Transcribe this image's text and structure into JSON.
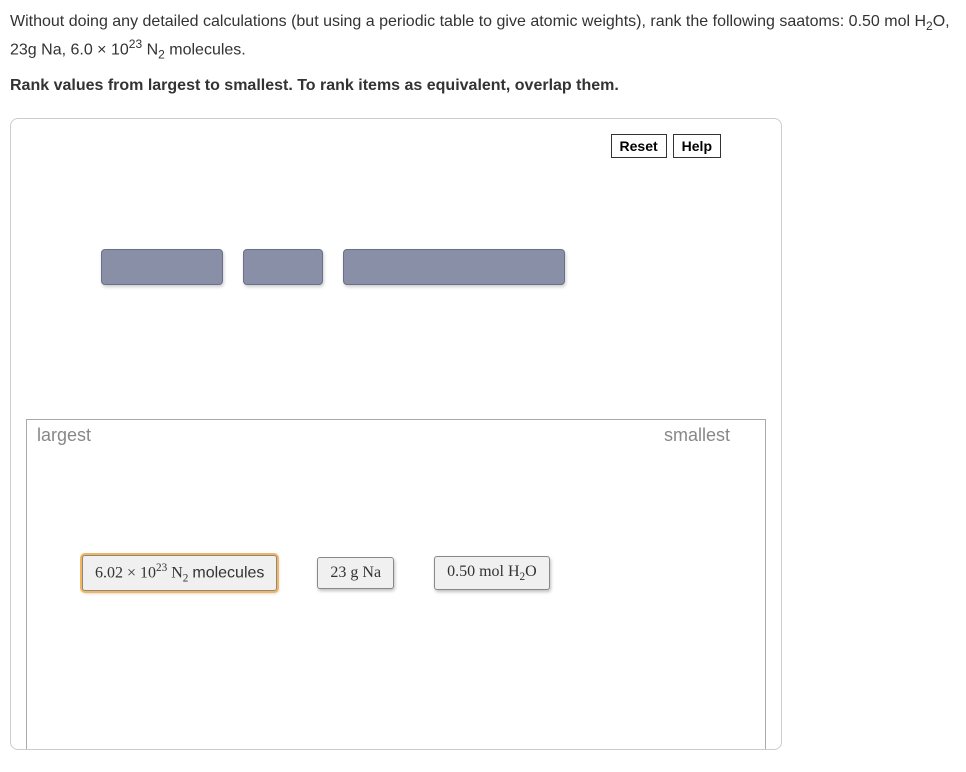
{
  "question": {
    "line1_parts": [
      "Without doing any detailed calculations (but using a periodic table to give atomic weights), rank the following sa",
      "atoms: 0.50 mol H",
      "2",
      "O, 23g Na, 6.0 × 10",
      "23",
      " N",
      "2",
      " molecules."
    ],
    "instruction": "Rank values from largest to smallest. To rank items as equivalent, overlap them."
  },
  "controls": {
    "reset": "Reset",
    "help": "Help"
  },
  "drop_labels": {
    "largest": "largest",
    "smallest": "smallest"
  },
  "items": {
    "a_parts": [
      "6.02 × 10",
      "23",
      " N",
      "2",
      " ",
      "molecules"
    ],
    "b_parts": [
      "23 g Na"
    ],
    "c_parts": [
      "0.50 mol H",
      "2",
      "O"
    ]
  }
}
